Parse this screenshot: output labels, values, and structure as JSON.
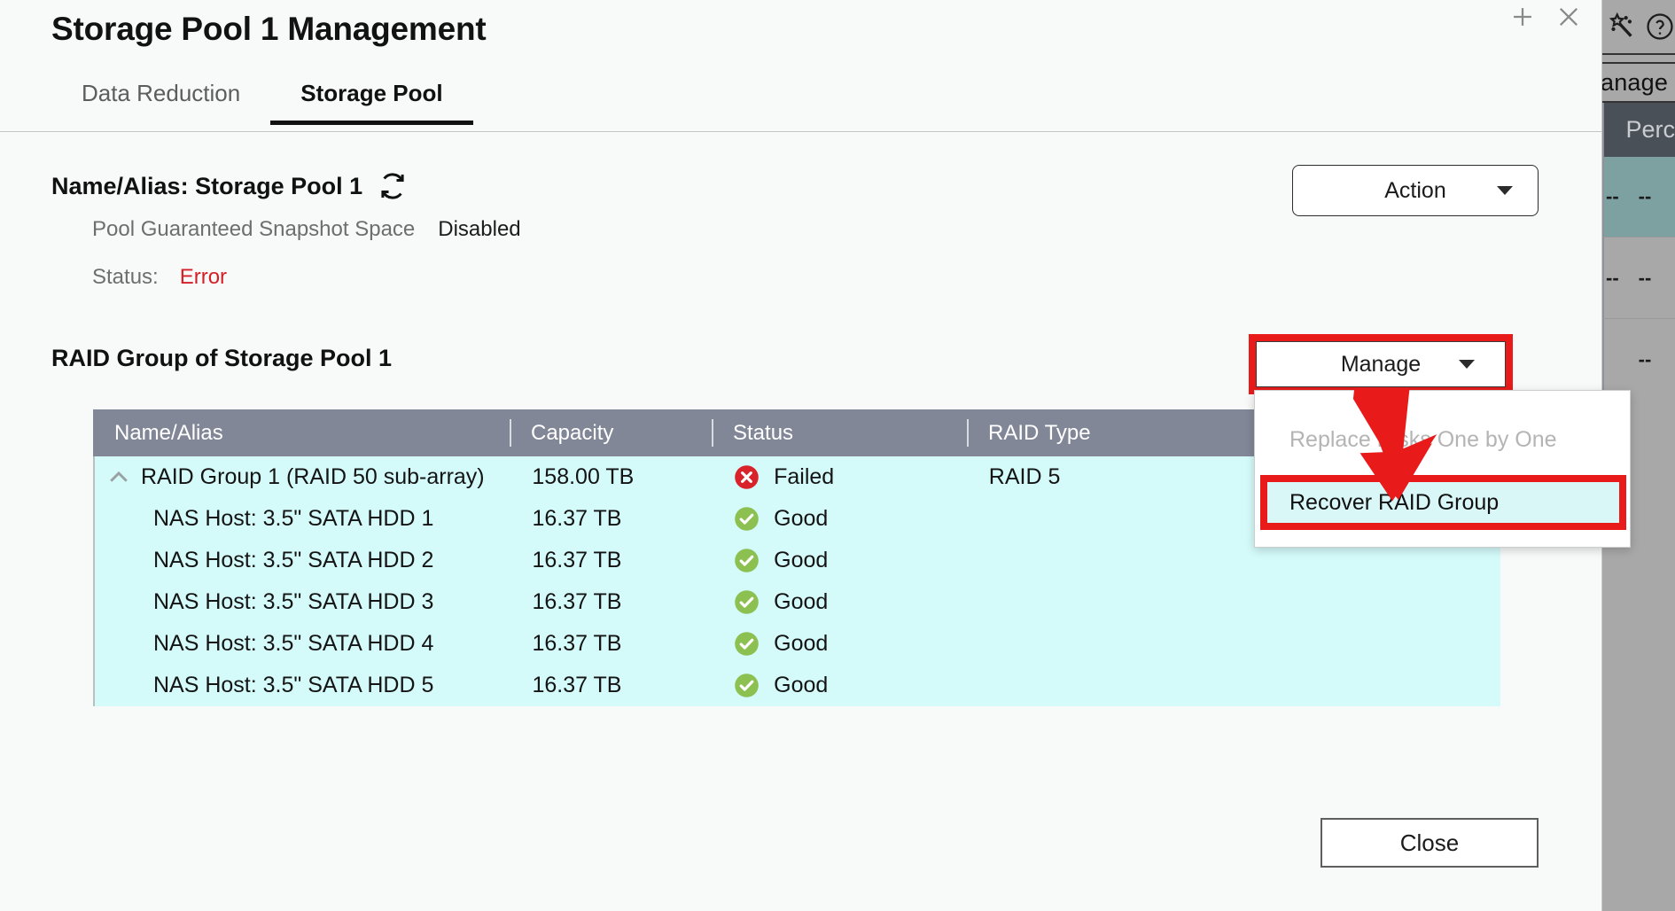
{
  "background": {
    "toolbar_icons": [
      "magic-wand-icon",
      "help-circle-icon"
    ],
    "manage_label": "anage",
    "column_header": "Perc",
    "row_values": [
      "--",
      "--",
      "--"
    ],
    "row_values_secondary": [
      "--",
      "--"
    ]
  },
  "titlebar": {
    "add_label": "+",
    "close_label": "×"
  },
  "dialog": {
    "title": "Storage Pool 1 Management",
    "tabs": [
      {
        "label": "Data Reduction",
        "active": false
      },
      {
        "label": "Storage Pool",
        "active": true
      }
    ],
    "name_alias": "Name/Alias: Storage Pool 1",
    "refresh_icon": "refresh-icon",
    "snapshot_space_label": "Pool Guaranteed Snapshot Space",
    "snapshot_space_value": "Disabled",
    "status_label": "Status:",
    "status_value": "Error",
    "status_color": "#d32028",
    "action_button": "Action",
    "raid_group_heading": "RAID Group of Storage Pool 1",
    "manage_button": "Manage",
    "close_button": "Close"
  },
  "dropdown": {
    "items": [
      {
        "label": "Replace Disks One by One",
        "disabled": true,
        "highlighted": false
      },
      {
        "label": "Recover RAID Group",
        "disabled": false,
        "highlighted": true
      }
    ],
    "highlight_color": "#e81a1a"
  },
  "table": {
    "columns": [
      "Name/Alias",
      "Capacity",
      "Status",
      "RAID Type"
    ],
    "rows": [
      {
        "kind": "group",
        "name": "RAID Group 1 (RAID 50 sub-array)",
        "capacity": "158.00 TB",
        "status": "Failed",
        "status_icon": "error-circle-icon",
        "raid_type": "RAID 5"
      },
      {
        "kind": "disk",
        "name": "NAS Host: 3.5\" SATA HDD 1",
        "capacity": "16.37 TB",
        "status": "Good",
        "status_icon": "check-circle-icon",
        "raid_type": ""
      },
      {
        "kind": "disk",
        "name": "NAS Host: 3.5\" SATA HDD 2",
        "capacity": "16.37 TB",
        "status": "Good",
        "status_icon": "check-circle-icon",
        "raid_type": ""
      },
      {
        "kind": "disk",
        "name": "NAS Host: 3.5\" SATA HDD 3",
        "capacity": "16.37 TB",
        "status": "Good",
        "status_icon": "check-circle-icon",
        "raid_type": ""
      },
      {
        "kind": "disk",
        "name": "NAS Host: 3.5\" SATA HDD 4",
        "capacity": "16.37 TB",
        "status": "Good",
        "status_icon": "check-circle-icon",
        "raid_type": ""
      },
      {
        "kind": "disk",
        "name": "NAS Host: 3.5\" SATA HDD 5",
        "capacity": "16.37 TB",
        "status": "Good",
        "status_icon": "check-circle-icon",
        "raid_type": ""
      }
    ],
    "row_bg": "#d4fafa",
    "header_bg": "#818796",
    "failed_color": "#d32028",
    "good_color": "#7cb342"
  }
}
